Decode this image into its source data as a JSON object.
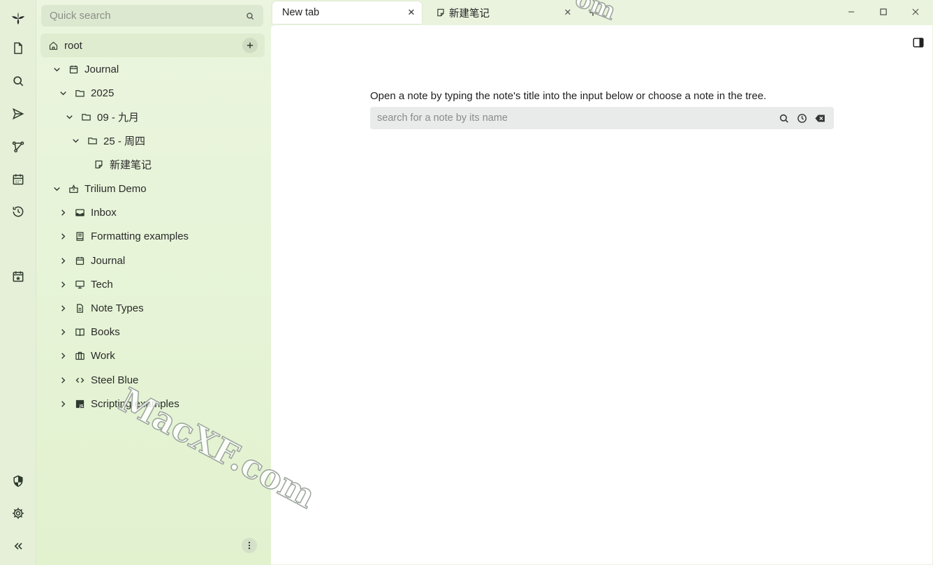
{
  "app": {
    "logo": "trilium-logo-icon"
  },
  "launcher": {
    "items": [
      {
        "name": "new-note",
        "icon": "file-icon"
      },
      {
        "name": "search",
        "icon": "search-icon"
      },
      {
        "name": "jump-to",
        "icon": "send-icon"
      },
      {
        "name": "note-map",
        "icon": "map-icon"
      },
      {
        "name": "calendar",
        "icon": "calendar-icon"
      },
      {
        "name": "recent-changes",
        "icon": "history-icon"
      },
      {
        "name": "today",
        "icon": "calendar-star-icon"
      },
      {
        "name": "protected-session",
        "icon": "shield-icon"
      },
      {
        "name": "settings",
        "icon": "gear-icon"
      },
      {
        "name": "collapse",
        "icon": "double-chevron-left-icon"
      }
    ]
  },
  "sidebar": {
    "search_placeholder": "Quick search",
    "tree": [
      {
        "label": "root",
        "icon": "home-icon"
      },
      {
        "label": "Journal",
        "icon": "calendar-icon",
        "expanded": true
      },
      {
        "label": "2025",
        "icon": "folder-icon",
        "expanded": true
      },
      {
        "label": "09 - 九月",
        "icon": "folder-icon",
        "expanded": true
      },
      {
        "label": "25 - 周四",
        "icon": "folder-icon",
        "expanded": true
      },
      {
        "label": "新建笔记",
        "icon": "note-icon"
      },
      {
        "label": "Trilium Demo",
        "icon": "box-icon",
        "expanded": true
      },
      {
        "label": "Inbox",
        "icon": "inbox-icon"
      },
      {
        "label": "Formatting examples",
        "icon": "book-icon"
      },
      {
        "label": "Journal",
        "icon": "calendar-icon"
      },
      {
        "label": "Tech",
        "icon": "monitor-icon"
      },
      {
        "label": "Note Types",
        "icon": "document-icon"
      },
      {
        "label": "Books",
        "icon": "open-book-icon"
      },
      {
        "label": "Work",
        "icon": "briefcase-icon"
      },
      {
        "label": "Steel Blue",
        "icon": "code-icon"
      },
      {
        "label": "Scripting examples",
        "icon": "js-icon"
      }
    ]
  },
  "tabs": [
    {
      "title": "New tab",
      "active": true
    },
    {
      "title": "新建笔记",
      "active": false,
      "icon": "note-icon"
    }
  ],
  "main": {
    "prompt": "Open a note by typing the note's title into the input below or choose a note in the tree.",
    "search_placeholder": "search for a note by its name"
  },
  "watermark": {
    "text": "MacXF.com",
    "text_top": "om"
  },
  "colors": {
    "sidebar_bg": "#e2f2cf",
    "launcher_bg": "#e6f0d8",
    "tab_active_bg": "#ffffff",
    "main_bg": "#ffffff"
  }
}
